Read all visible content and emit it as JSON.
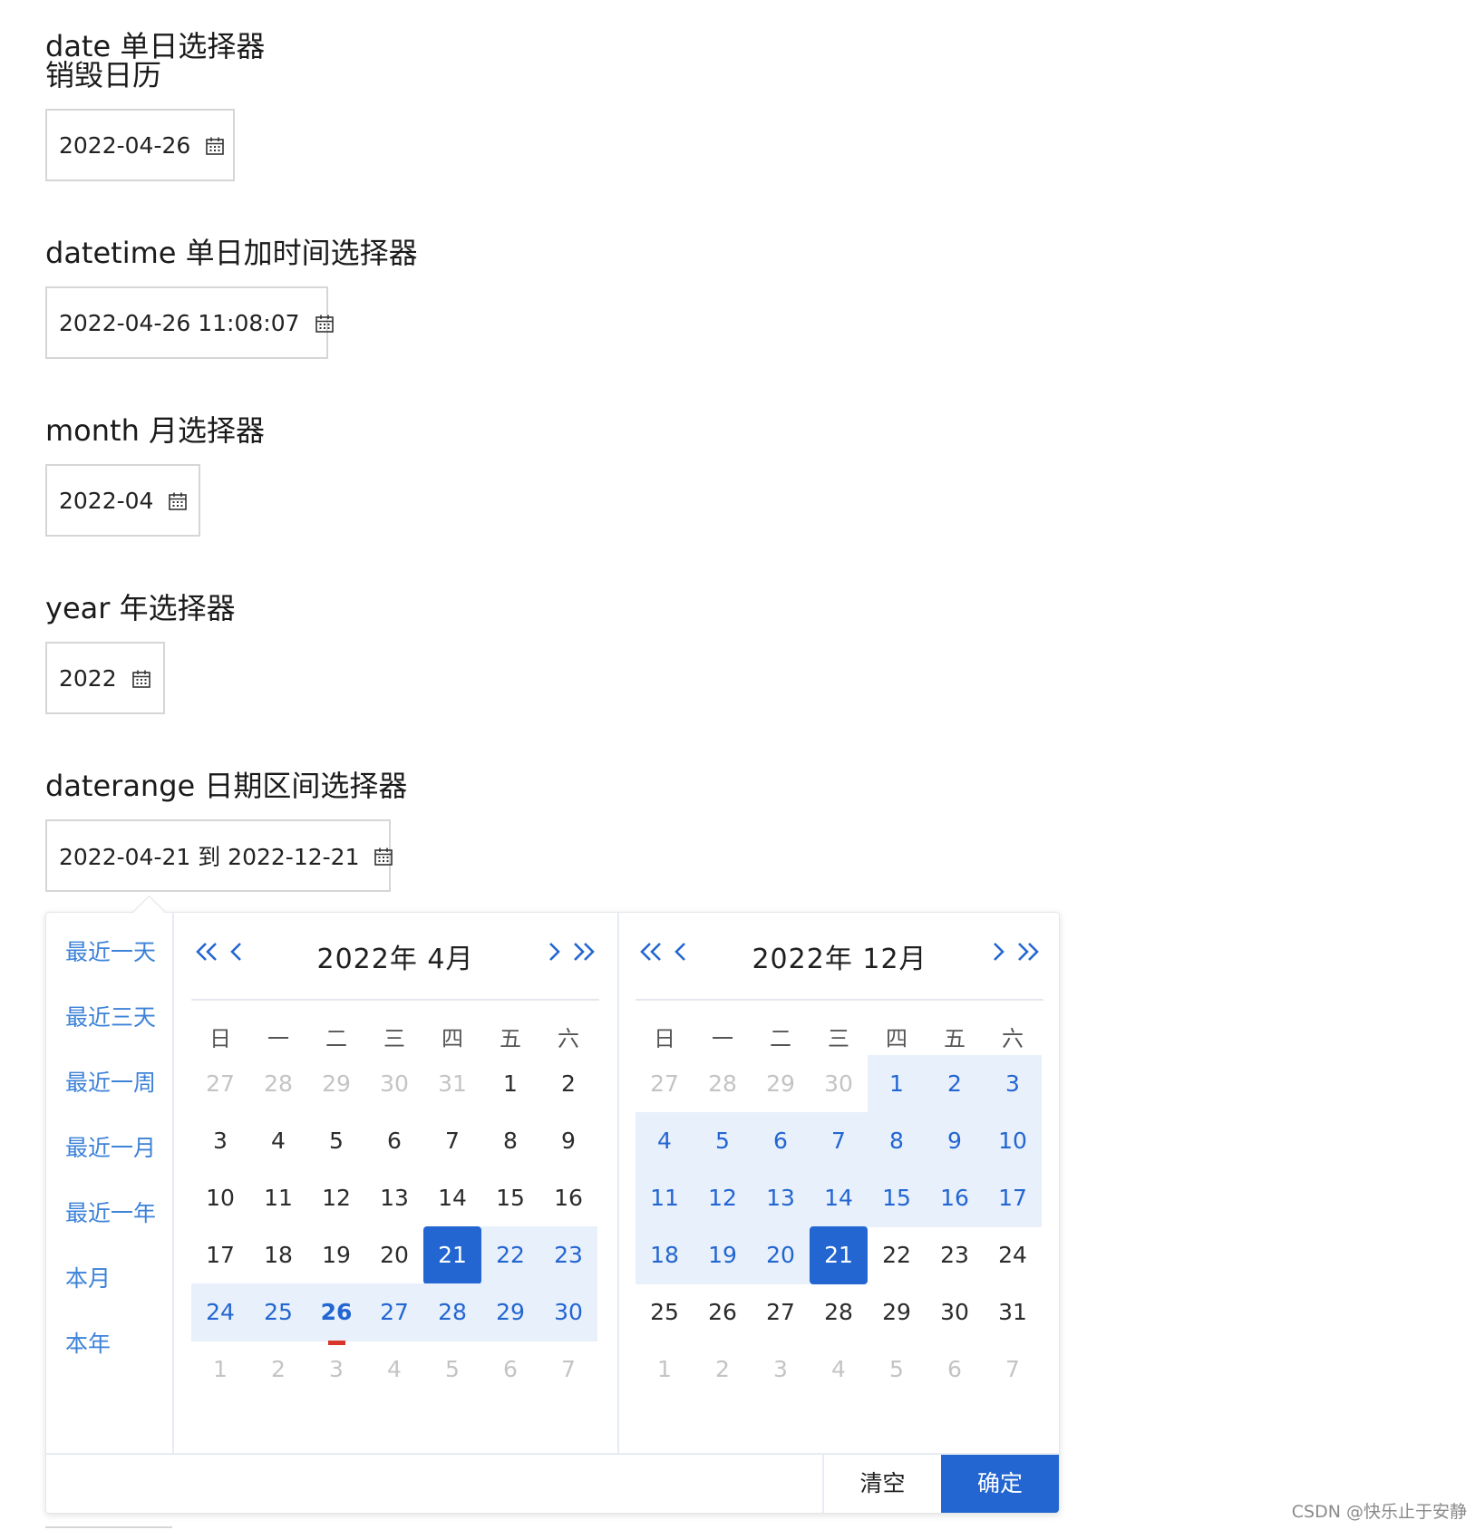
{
  "sections": [
    {
      "title": "date 单日选择器",
      "subtitle": "销毁日历",
      "value": "2022-04-26"
    },
    {
      "title": "datetime 单日加时间选择器",
      "value": "2022-04-26 11:08:07"
    },
    {
      "title": "month 月选择器",
      "value": "2022-04"
    },
    {
      "title": "year 年选择器",
      "value": "2022"
    },
    {
      "title": "daterange 日期区间选择器",
      "value": "2022-04-21 到 2022-12-21"
    }
  ],
  "picker": {
    "shortcuts": [
      "最近一天",
      "最近三天",
      "最近一周",
      "最近一月",
      "最近一年",
      "本月",
      "本年"
    ],
    "weekdays": [
      "日",
      "一",
      "二",
      "三",
      "四",
      "五",
      "六"
    ],
    "left_month": "2022年 4月",
    "right_month": "2022年 12月",
    "left_days": [
      [
        {
          "d": "27",
          "s": "out"
        },
        {
          "d": "28",
          "s": "out"
        },
        {
          "d": "29",
          "s": "out"
        },
        {
          "d": "30",
          "s": "out"
        },
        {
          "d": "31",
          "s": "out"
        },
        {
          "d": "1",
          "s": ""
        },
        {
          "d": "2",
          "s": ""
        }
      ],
      [
        {
          "d": "3",
          "s": ""
        },
        {
          "d": "4",
          "s": ""
        },
        {
          "d": "5",
          "s": ""
        },
        {
          "d": "6",
          "s": ""
        },
        {
          "d": "7",
          "s": ""
        },
        {
          "d": "8",
          "s": ""
        },
        {
          "d": "9",
          "s": ""
        }
      ],
      [
        {
          "d": "10",
          "s": ""
        },
        {
          "d": "11",
          "s": ""
        },
        {
          "d": "12",
          "s": ""
        },
        {
          "d": "13",
          "s": ""
        },
        {
          "d": "14",
          "s": ""
        },
        {
          "d": "15",
          "s": ""
        },
        {
          "d": "16",
          "s": ""
        }
      ],
      [
        {
          "d": "17",
          "s": ""
        },
        {
          "d": "18",
          "s": ""
        },
        {
          "d": "19",
          "s": ""
        },
        {
          "d": "20",
          "s": ""
        },
        {
          "d": "21",
          "s": "sel"
        },
        {
          "d": "22",
          "s": "range"
        },
        {
          "d": "23",
          "s": "range"
        }
      ],
      [
        {
          "d": "24",
          "s": "range"
        },
        {
          "d": "25",
          "s": "range"
        },
        {
          "d": "26",
          "s": "range today"
        },
        {
          "d": "27",
          "s": "range"
        },
        {
          "d": "28",
          "s": "range"
        },
        {
          "d": "29",
          "s": "range"
        },
        {
          "d": "30",
          "s": "range"
        }
      ],
      [
        {
          "d": "1",
          "s": "out"
        },
        {
          "d": "2",
          "s": "out"
        },
        {
          "d": "3",
          "s": "out"
        },
        {
          "d": "4",
          "s": "out"
        },
        {
          "d": "5",
          "s": "out"
        },
        {
          "d": "6",
          "s": "out"
        },
        {
          "d": "7",
          "s": "out"
        }
      ]
    ],
    "right_days": [
      [
        {
          "d": "27",
          "s": "out"
        },
        {
          "d": "28",
          "s": "out"
        },
        {
          "d": "29",
          "s": "out"
        },
        {
          "d": "30",
          "s": "out"
        },
        {
          "d": "1",
          "s": "range"
        },
        {
          "d": "2",
          "s": "range"
        },
        {
          "d": "3",
          "s": "range"
        }
      ],
      [
        {
          "d": "4",
          "s": "range"
        },
        {
          "d": "5",
          "s": "range"
        },
        {
          "d": "6",
          "s": "range"
        },
        {
          "d": "7",
          "s": "range"
        },
        {
          "d": "8",
          "s": "range"
        },
        {
          "d": "9",
          "s": "range"
        },
        {
          "d": "10",
          "s": "range"
        }
      ],
      [
        {
          "d": "11",
          "s": "range"
        },
        {
          "d": "12",
          "s": "range"
        },
        {
          "d": "13",
          "s": "range"
        },
        {
          "d": "14",
          "s": "range"
        },
        {
          "d": "15",
          "s": "range"
        },
        {
          "d": "16",
          "s": "range"
        },
        {
          "d": "17",
          "s": "range"
        }
      ],
      [
        {
          "d": "18",
          "s": "range"
        },
        {
          "d": "19",
          "s": "range"
        },
        {
          "d": "20",
          "s": "range"
        },
        {
          "d": "21",
          "s": "sel"
        },
        {
          "d": "22",
          "s": ""
        },
        {
          "d": "23",
          "s": ""
        },
        {
          "d": "24",
          "s": ""
        }
      ],
      [
        {
          "d": "25",
          "s": ""
        },
        {
          "d": "26",
          "s": ""
        },
        {
          "d": "27",
          "s": ""
        },
        {
          "d": "28",
          "s": ""
        },
        {
          "d": "29",
          "s": ""
        },
        {
          "d": "30",
          "s": ""
        },
        {
          "d": "31",
          "s": ""
        }
      ],
      [
        {
          "d": "1",
          "s": "out"
        },
        {
          "d": "2",
          "s": "out"
        },
        {
          "d": "3",
          "s": "out"
        },
        {
          "d": "4",
          "s": "out"
        },
        {
          "d": "5",
          "s": "out"
        },
        {
          "d": "6",
          "s": "out"
        },
        {
          "d": "7",
          "s": "out"
        }
      ]
    ],
    "clear_label": "清空",
    "confirm_label": "确定",
    "accent_color": "#2366d1",
    "range_color": "#e8f0fb",
    "shortcut_color": "#3c82d8",
    "today_marker_color": "#d9362b",
    "nav_icons": [
      "double-chevron-left-icon",
      "chevron-left-icon",
      "chevron-right-icon",
      "double-chevron-right-icon"
    ]
  },
  "watermark": "CSDN @快乐止于安静"
}
